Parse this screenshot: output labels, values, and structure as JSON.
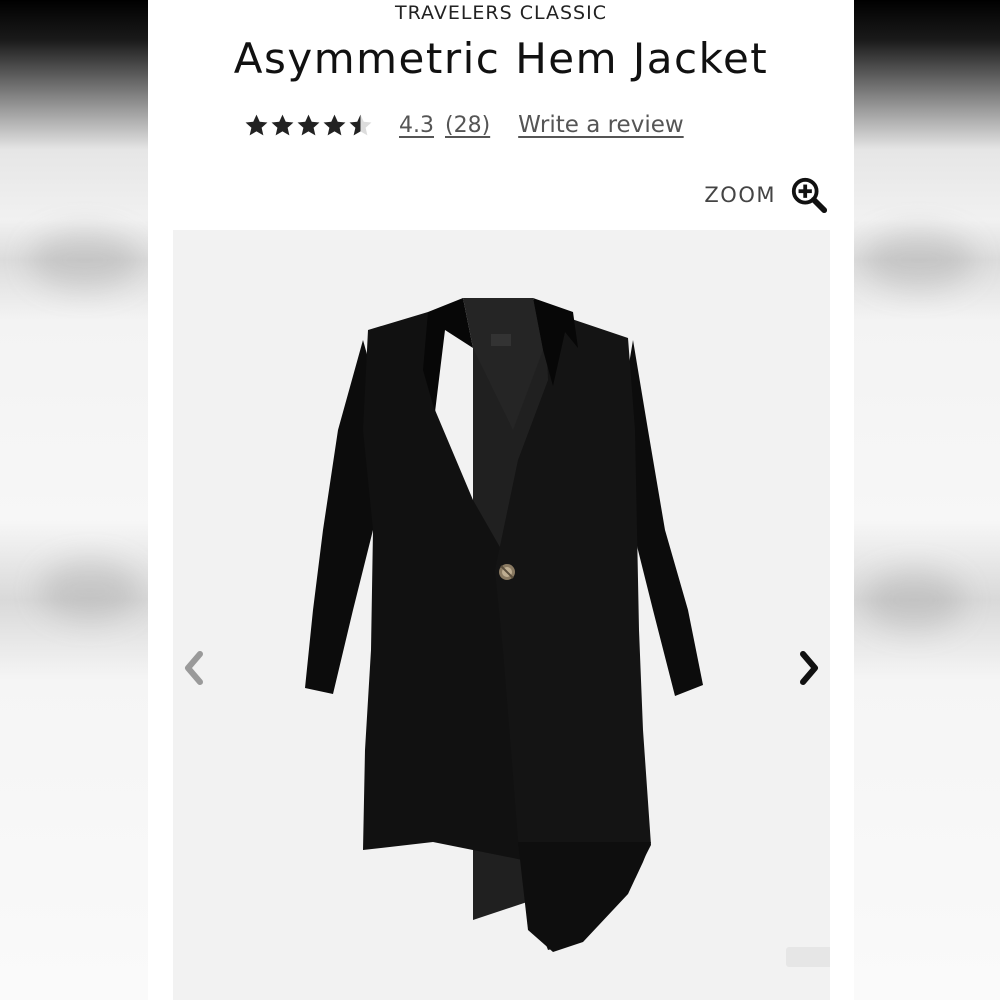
{
  "product": {
    "brand": "TRAVELERS CLASSIC",
    "title": "Asymmetric Hem Jacket"
  },
  "rating": {
    "value": "4.3",
    "stars_filled_fraction": 0.86,
    "count": "(28)",
    "write_review_label": "Write a review"
  },
  "zoom": {
    "label": "ZOOM",
    "icon": "zoom-in-magnifier-icon"
  },
  "gallery": {
    "prev_icon": "chevron-left-icon",
    "next_icon": "chevron-right-icon",
    "image": "black-asymmetric-jacket-photo"
  },
  "colors": {
    "text": "#111111",
    "muted": "#555555",
    "star": "#222222",
    "image_bg": "#f2f2f2",
    "prev_arrow": "#9a9a9a",
    "next_arrow": "#111111"
  }
}
